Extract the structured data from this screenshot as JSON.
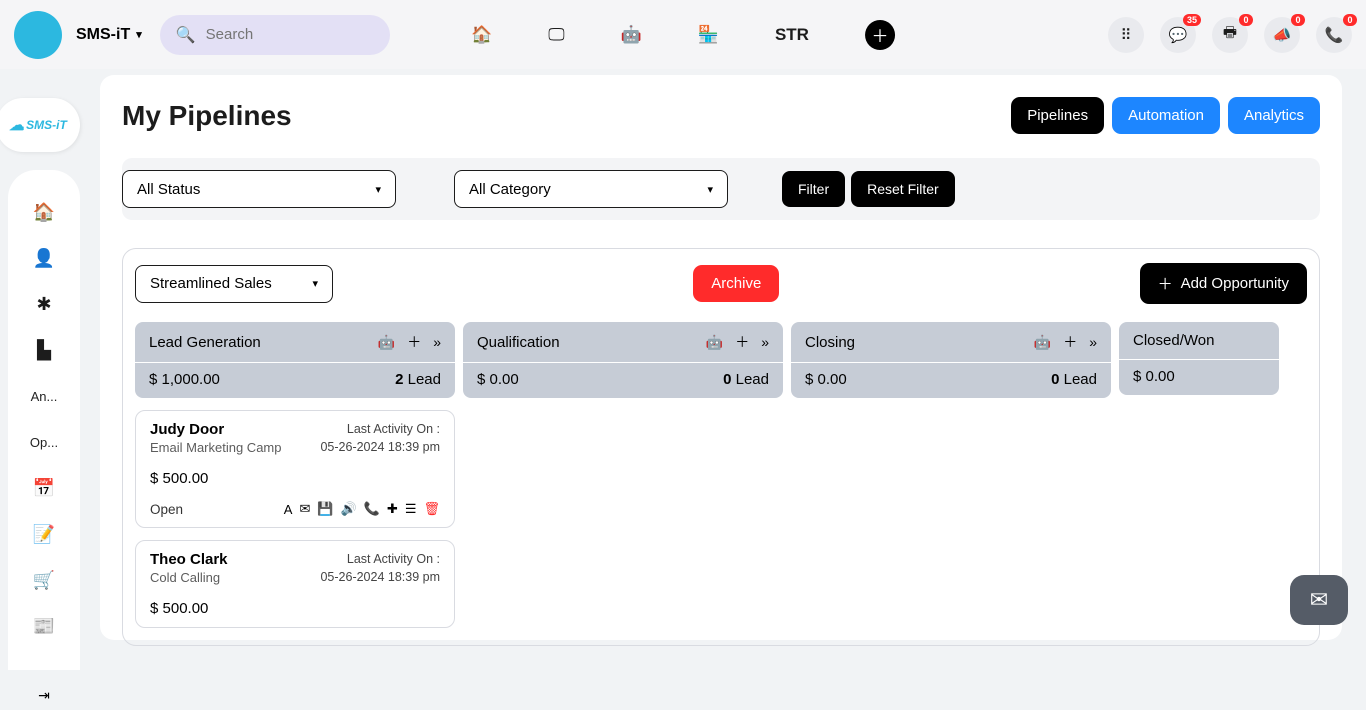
{
  "header": {
    "brand": "SMS-iT",
    "search_placeholder": "Search",
    "str": "STR",
    "badges": {
      "chat": "35",
      "print": "0",
      "bull": "0",
      "phone": "0"
    }
  },
  "sidebar": {
    "badge_text": "SMS-iT",
    "items": [
      "An...",
      "Op..."
    ]
  },
  "page": {
    "title": "My Pipelines",
    "tabs": {
      "pipelines": "Pipelines",
      "automation": "Automation",
      "analytics": "Analytics"
    }
  },
  "filters": {
    "status": "All Status",
    "category": "All Category",
    "filter_btn": "Filter",
    "reset_btn": "Reset Filter"
  },
  "pipeline": {
    "selected": "Streamlined Sales",
    "archive": "Archive",
    "add": "Add Opportunity"
  },
  "stages": [
    {
      "name": "Lead Generation",
      "amount": "$ 1,000.00",
      "count": "2",
      "lead": "Lead"
    },
    {
      "name": "Qualification",
      "amount": "$ 0.00",
      "count": "0",
      "lead": "Lead"
    },
    {
      "name": "Closing",
      "amount": "$ 0.00",
      "count": "0",
      "lead": "Lead"
    },
    {
      "name": "Closed/Won",
      "amount": "$ 0.00",
      "count": "",
      "lead": ""
    }
  ],
  "cards": [
    {
      "name": "Judy Door",
      "source": "Email Marketing Camp",
      "activity_label": "Last Activity On :",
      "activity_date": "05-26-2024 18:39 pm",
      "amount": "$ 500.00",
      "status": "Open"
    },
    {
      "name": "Theo Clark",
      "source": "Cold Calling",
      "activity_label": "Last Activity On :",
      "activity_date": "05-26-2024 18:39 pm",
      "amount": "$ 500.00",
      "status": ""
    }
  ]
}
